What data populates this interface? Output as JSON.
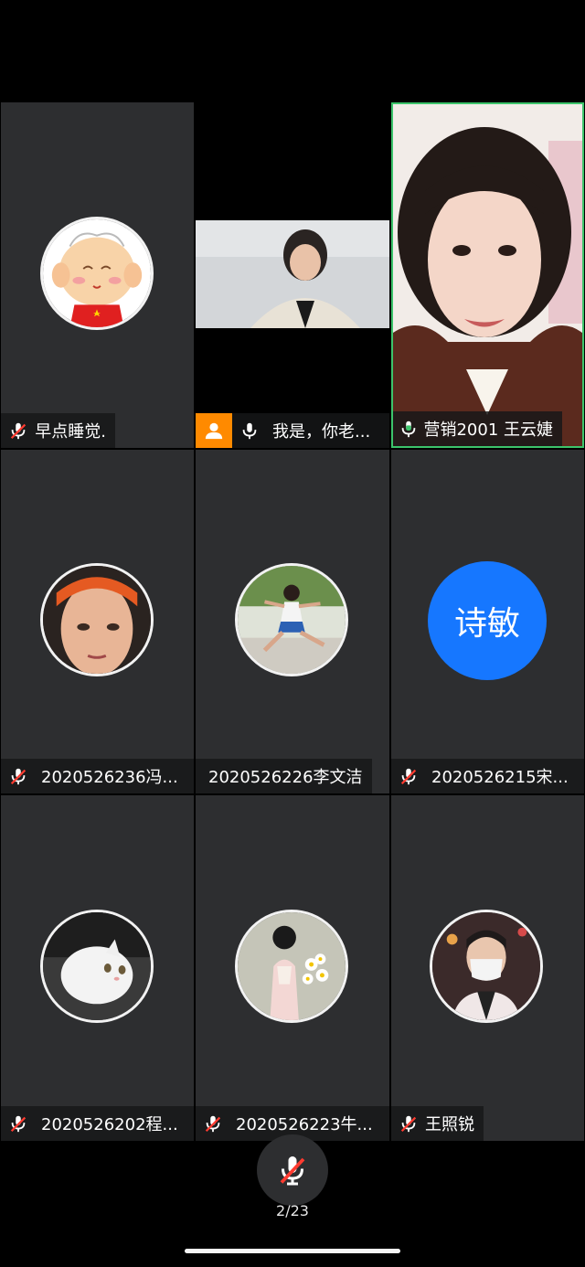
{
  "tiles": [
    {
      "name": "早点睡觉.",
      "mic": "muted"
    },
    {
      "name": "我是，你老...",
      "mic": "on"
    },
    {
      "name": "营销2001 王云婕",
      "mic": "speaking"
    },
    {
      "name": "2020526236冯...",
      "mic": "muted"
    },
    {
      "name": "2020526226李文洁",
      "mic": "none"
    },
    {
      "name": "2020526215宋...",
      "mic": "muted",
      "avatar_text": "诗敏"
    },
    {
      "name": "2020526202程...",
      "mic": "muted"
    },
    {
      "name": "2020526223牛...",
      "mic": "muted"
    },
    {
      "name": "王照锐",
      "mic": "muted"
    }
  ],
  "footer": {
    "page_counter": "2/23"
  },
  "colors": {
    "accent_blue": "#1677ff",
    "active_border": "#3cc46b",
    "muted_red": "#ff3b30",
    "badge_orange": "#ff8a00"
  },
  "icons": [
    "mic-muted-icon",
    "mic-icon",
    "mic-speaking-icon",
    "person-icon"
  ]
}
